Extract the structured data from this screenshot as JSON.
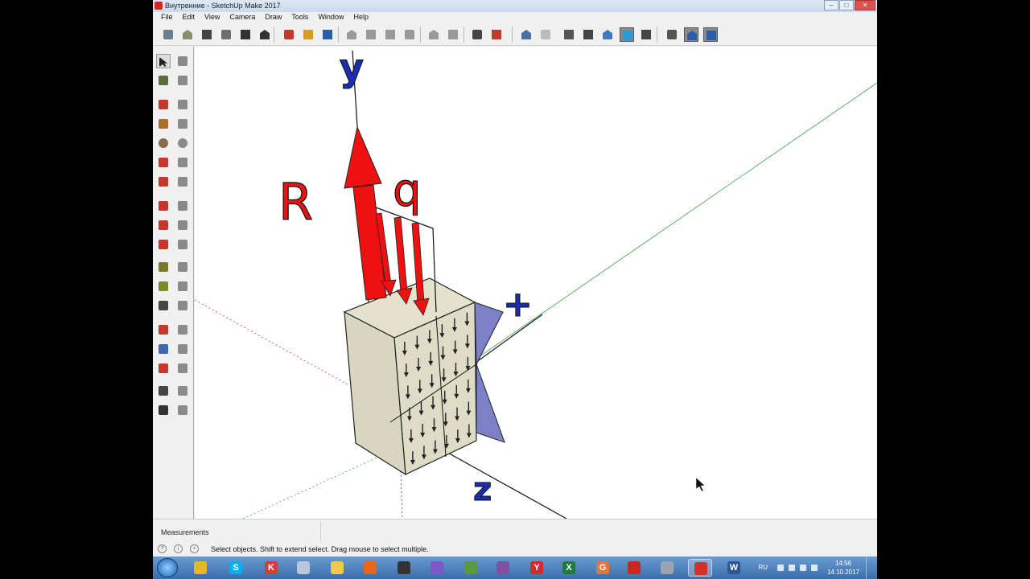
{
  "window": {
    "title": "Внутренние - SketchUp Make 2017",
    "controls": [
      "minimize",
      "maximize",
      "close"
    ]
  },
  "menu": [
    "File",
    "Edit",
    "View",
    "Camera",
    "Draw",
    "Tools",
    "Window",
    "Help"
  ],
  "toolbar": {
    "buttons": [
      "getting-started-icon",
      "3d-warehouse-icon",
      "home-icon",
      "share-model-icon",
      "house-outline-icon",
      "warehouse-icon",
      "new-icon",
      "open-icon",
      "save-icon",
      "cut-icon",
      "copy-icon",
      "paste-icon",
      "erase-icon",
      "undo-icon",
      "redo-icon",
      "print-icon",
      "model-info-icon",
      "xray-icon",
      "back-edges-icon",
      "wireframe-icon",
      "hidden-line-icon",
      "shaded-icon",
      "shaded-textures-icon",
      "monochrome-icon",
      "position-camera-icon",
      "iso-view-icon",
      "top-view-icon"
    ]
  },
  "left_tools": [
    [
      "select-icon",
      "component-icon"
    ],
    [
      "paint-bucket-icon",
      "eraser-icon"
    ],
    [
      "line-icon",
      "freehand-icon"
    ],
    [
      "rectangle-icon",
      "rotated-rectangle-icon"
    ],
    [
      "circle-icon",
      "polygon-icon"
    ],
    [
      "arc-icon",
      "two-point-arc-icon"
    ],
    [
      "three-point-arc-icon",
      "pie-icon"
    ],
    [
      "move-icon",
      "push-pull-icon"
    ],
    [
      "rotate-icon",
      "follow-me-icon"
    ],
    [
      "scale-icon",
      "offset-icon"
    ],
    [
      "tape-measure-icon",
      "dimension-icon"
    ],
    [
      "protractor-icon",
      "text-icon"
    ],
    [
      "axes-icon",
      "3d-text-icon"
    ],
    [
      "orbit-icon",
      "pan-icon"
    ],
    [
      "zoom-icon",
      "zoom-window-icon"
    ],
    [
      "zoom-extents-icon",
      "previous-view-icon"
    ],
    [
      "position-camera-icon",
      "look-around-icon"
    ],
    [
      "walk-icon",
      "section-plane-icon"
    ]
  ],
  "viewport": {
    "labels": {
      "y": "y",
      "R": "R",
      "q": "q",
      "x": "+",
      "z": "z"
    },
    "colors": {
      "force": "#ee1111",
      "axis_label": "#1a2fb0",
      "block": "#d9d6bf",
      "stress": "#7d82c8",
      "axis_green": "#3aa040"
    }
  },
  "bottom": {
    "measurements_label": "Measurements",
    "status_text": "Select objects. Shift to extend select. Drag mouse to select multiple."
  },
  "taskbar": {
    "apps": [
      {
        "icon": "chrome-icon",
        "color": "#e8b82a",
        "glyph": ""
      },
      {
        "icon": "skype-icon",
        "color": "#00aff0",
        "glyph": "S"
      },
      {
        "icon": "kaspersky-icon",
        "color": "#d83b3b",
        "glyph": "K"
      },
      {
        "icon": "archiver-icon",
        "color": "#b9c7d8",
        "glyph": ""
      },
      {
        "icon": "explorer-icon",
        "color": "#f2c94c",
        "glyph": ""
      },
      {
        "icon": "firefox-icon",
        "color": "#e8671b",
        "glyph": ""
      },
      {
        "icon": "obs-icon",
        "color": "#333333",
        "glyph": ""
      },
      {
        "icon": "pen-icon",
        "color": "#7b59c9",
        "glyph": ""
      },
      {
        "icon": "settings-icon",
        "color": "#5a9a3a",
        "glyph": ""
      },
      {
        "icon": "viber-icon",
        "color": "#7d51a0",
        "glyph": ""
      },
      {
        "icon": "yandex-icon",
        "color": "#d52a2a",
        "glyph": "Y"
      },
      {
        "icon": "excel-icon",
        "color": "#1f7a3c",
        "glyph": "X"
      },
      {
        "icon": "gmail-icon",
        "color": "#e7743a",
        "glyph": "G"
      },
      {
        "icon": "acrobat-icon",
        "color": "#c8291f",
        "glyph": ""
      },
      {
        "icon": "tools-icon",
        "color": "#9aa4b0",
        "glyph": ""
      },
      {
        "icon": "sketchup-icon",
        "color": "#d92e2e",
        "glyph": ""
      },
      {
        "icon": "word-icon",
        "color": "#2b579a",
        "glyph": "W"
      }
    ],
    "tray": {
      "language": "RU",
      "time": "14:56",
      "date": "14.10.2017"
    }
  }
}
